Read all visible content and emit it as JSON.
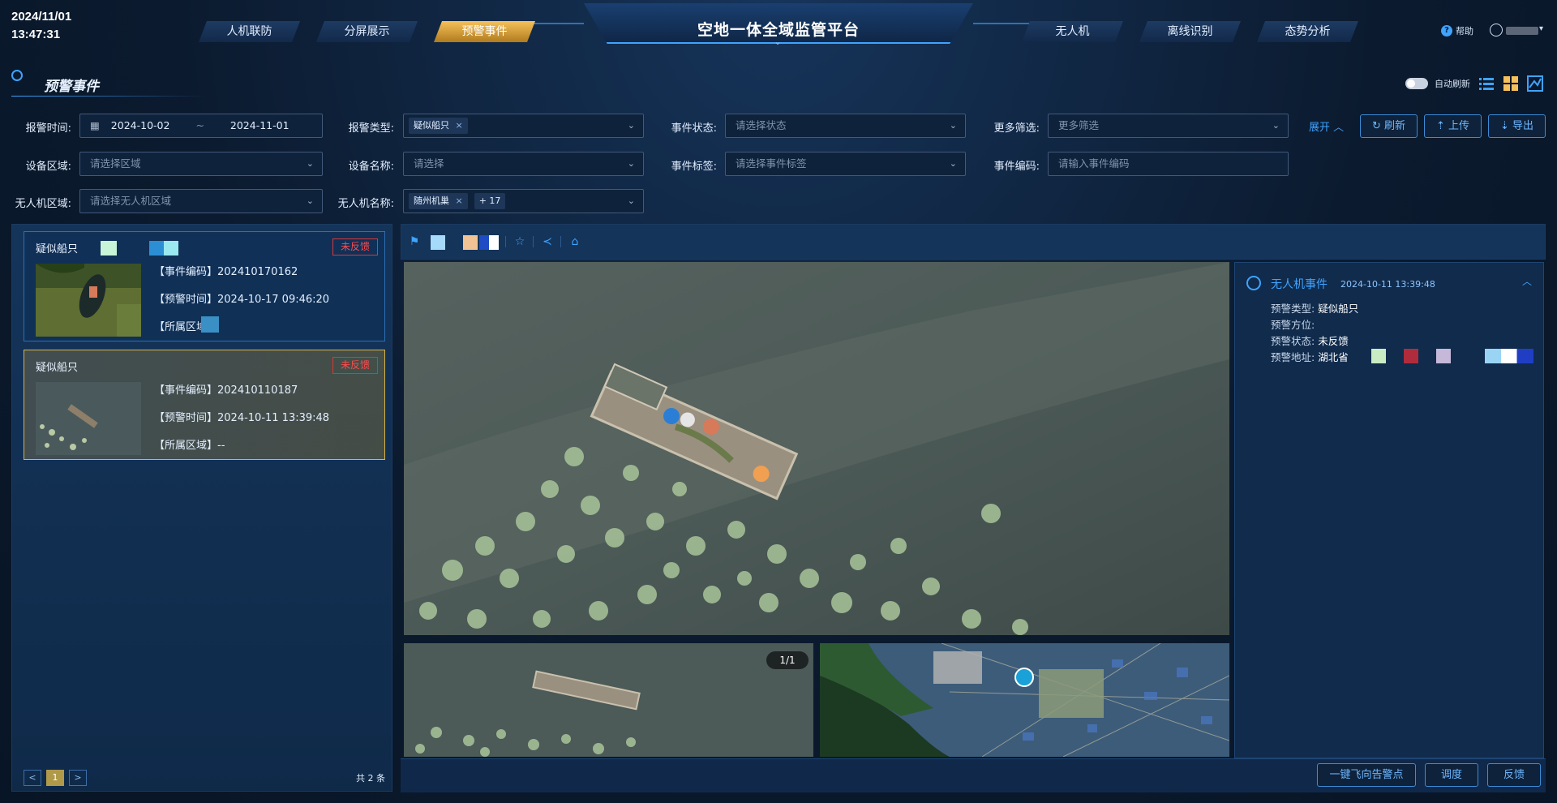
{
  "header": {
    "date": "2024/11/01",
    "time": "13:47:31",
    "title": "空地一体全域监管平台",
    "nav_left": [
      "人机联防",
      "分屏展示",
      "预警事件"
    ],
    "nav_right": [
      "无人机",
      "离线识别",
      "态势分析"
    ],
    "active_tab": "预警事件",
    "help": "帮助"
  },
  "page": {
    "title": "预警事件",
    "auto_refresh": "自动刷新"
  },
  "filters": {
    "alarm_time_label": "报警时间:",
    "start_date": "2024-10-02",
    "date_sep": "~",
    "end_date": "2024-11-01",
    "alarm_type_label": "报警类型:",
    "alarm_type_tag": "疑似船只",
    "event_status_label": "事件状态:",
    "event_status_placeholder": "请选择状态",
    "more_filters_label": "更多筛选:",
    "more_filters_placeholder": "更多筛选",
    "expand": "展开",
    "device_area_label": "设备区域:",
    "device_area_placeholder": "请选择区域",
    "device_name_label": "设备名称:",
    "device_name_placeholder": "请选择",
    "event_tag_label": "事件标签:",
    "event_tag_placeholder": "请选择事件标签",
    "event_code_label": "事件编码:",
    "event_code_placeholder": "请输入事件编码",
    "uav_area_label": "无人机区域:",
    "uav_area_placeholder": "请选择无人机区域",
    "uav_name_label": "无人机名称:",
    "uav_name_tag": "随州机巢",
    "uav_name_more": "+ 17"
  },
  "buttons": {
    "refresh": "刷新",
    "upload": "上传",
    "export": "导出"
  },
  "events": [
    {
      "title": "疑似船只",
      "status": "未反馈",
      "code_line": "【事件编码】202410170162",
      "time_line": "【预警时间】2024-10-17 09:46:20",
      "area_line": "【所属区域】"
    },
    {
      "title": "疑似船只",
      "status": "未反馈",
      "code_line": "【事件编码】202410110187",
      "time_line": "【预警时间】2024-10-11 13:39:48",
      "area_line": "【所属区域】--"
    }
  ],
  "pagination": {
    "prev": "<",
    "current": "1",
    "next": ">",
    "total": "共 2 条"
  },
  "detail": {
    "page_indicator": "1/1",
    "info_title": "无人机事件",
    "info_time": "2024-10-11 13:39:48",
    "rows": [
      {
        "label": "预警类型:",
        "value": "疑似船只"
      },
      {
        "label": "预警方位:",
        "value": ""
      },
      {
        "label": "预警状态:",
        "value": "未反馈"
      },
      {
        "label": "预警地址:",
        "value": "湖北省"
      }
    ]
  },
  "actions": {
    "fly_to": "一键飞向告警点",
    "dispatch": "调度",
    "feedback": "反馈"
  },
  "colors": {
    "accent": "#3fa3ff",
    "active_tab": "#f6c15b",
    "status_red": "#ff4b4b",
    "selected_border": "#d7b54c"
  }
}
